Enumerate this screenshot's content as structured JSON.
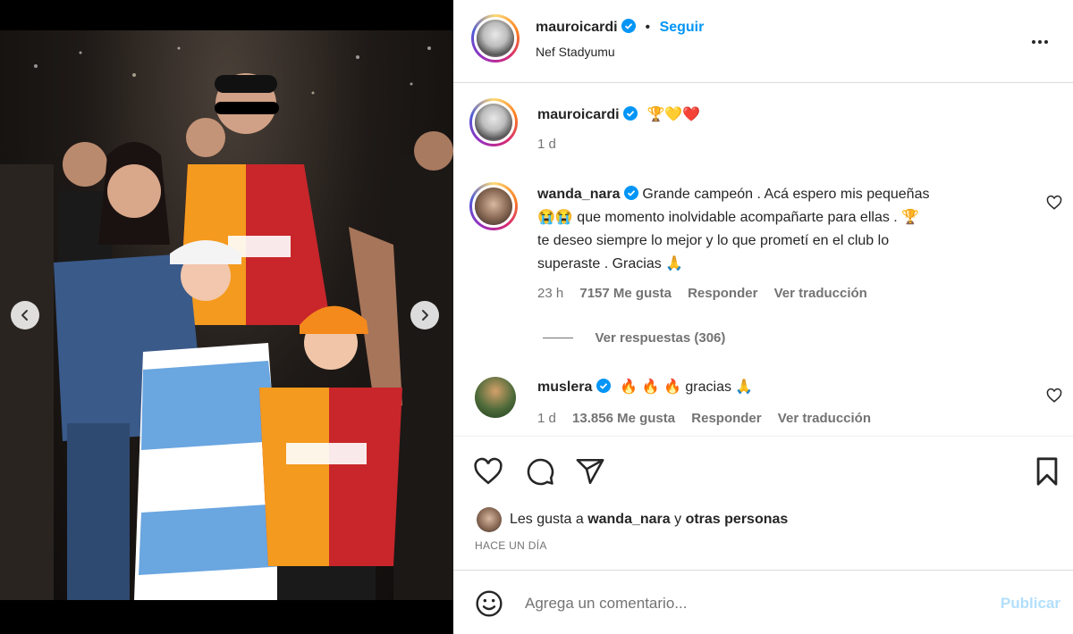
{
  "post": {
    "author": "mauroicardi",
    "follow_label": "Seguir",
    "location": "Nef Stadyumu",
    "separator": "•"
  },
  "caption": {
    "author": "mauroicardi",
    "text": "🏆💛❤️",
    "time": "1 d"
  },
  "comments": [
    {
      "author": "wanda_nara",
      "text_lines": [
        "Grande campeón . Acá espero mis pequeñas",
        "😭😭 que momento inolvidable acompañarte para ellas . 🏆",
        "te deseo siempre lo mejor y lo que prometí en el club lo",
        "superaste . Gracias 🙏"
      ],
      "time": "23 h",
      "likes": "7157 Me gusta",
      "reply": "Responder",
      "translate": "Ver traducción",
      "view_replies": "Ver respuestas (306)"
    },
    {
      "author": "muslera",
      "text": "🔥 🔥 🔥  gracias 🙏",
      "time": "1 d",
      "likes": "13.856 Me gusta",
      "reply": "Responder",
      "translate": "Ver traducción"
    }
  ],
  "likes": {
    "prefix": "Les gusta a",
    "user": "wanda_nara",
    "connector": "y",
    "others": "otras personas"
  },
  "timestamp": "HACE UN DÍA",
  "composer": {
    "placeholder": "Agrega un comentario...",
    "publish_label": "Publicar"
  },
  "carousel": {
    "count": 11,
    "active_index": 5
  },
  "icons": [
    "chevron-left-icon",
    "chevron-right-icon",
    "more-icon",
    "verified-icon",
    "heart-icon",
    "comment-icon",
    "share-icon",
    "bookmark-icon",
    "emoji-icon"
  ],
  "colors": {
    "accent": "#0095f6",
    "publish_disabled": "#b2dffc",
    "verified": "#0095f6",
    "text": "#262626",
    "muted": "#737373"
  }
}
